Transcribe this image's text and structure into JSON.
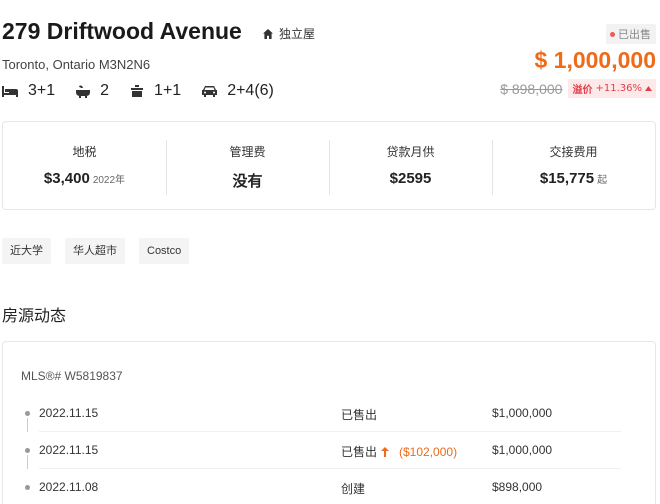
{
  "listing": {
    "title": "279 Driftwood Avenue",
    "property_type": "独立屋",
    "address": "Toronto, Ontario M3N2N6",
    "status_badge": "已出售",
    "price": "$ 1,000,000",
    "original_price": "$ 898,000",
    "premium_label": "溢价",
    "premium_value": "+11.36%",
    "features": {
      "bedrooms": "3+1",
      "bathrooms": "2",
      "kitchens": "1+1",
      "parking": "2+4(6)"
    },
    "colors": {
      "accent": "#ee6b1a",
      "premium_red": "#e0404a"
    }
  },
  "stats": [
    {
      "label": "地税",
      "value": "$3,400",
      "suffix": "2022年"
    },
    {
      "label": "管理费",
      "value": "没有",
      "suffix": ""
    },
    {
      "label": "贷款月供",
      "value": "$2595",
      "suffix": ""
    },
    {
      "label": "交接费用",
      "value": "$15,775",
      "suffix": "起"
    }
  ],
  "tags": [
    "近大学",
    "华人超市",
    "Costco"
  ],
  "history": {
    "section_title": "房源动态",
    "mls": "MLS®# W5819837",
    "rows": [
      {
        "date": "2022.11.15",
        "status": "已售出",
        "change": "",
        "amount": "$1,000,000"
      },
      {
        "date": "2022.11.15",
        "status": "已售出",
        "change": "($102,000)",
        "amount": "$1,000,000"
      },
      {
        "date": "2022.11.08",
        "status": "创建",
        "change": "",
        "amount": "$898,000"
      }
    ]
  },
  "icons": [
    "home-icon",
    "bed-icon",
    "bath-icon",
    "kitchen-icon",
    "car-icon",
    "arrow-up-icon",
    "triangle-up-icon"
  ]
}
